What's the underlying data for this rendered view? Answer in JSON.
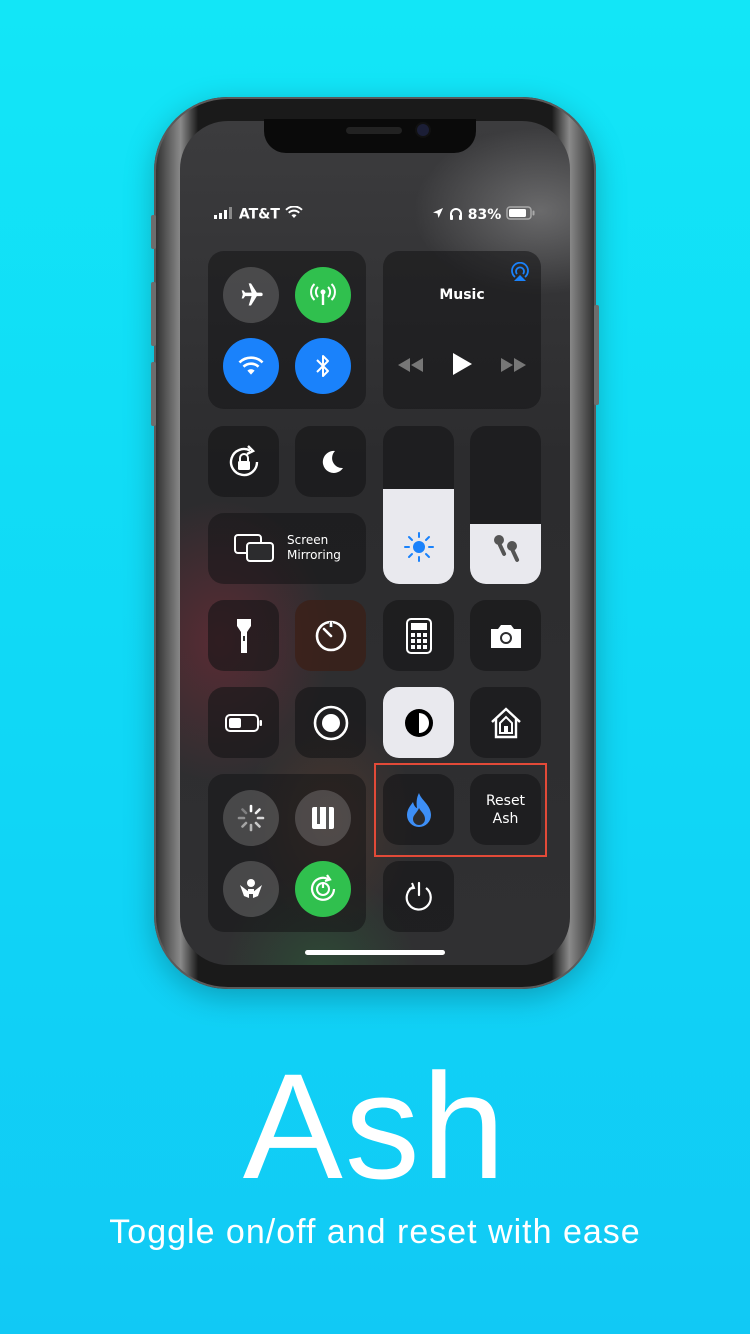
{
  "status_bar": {
    "carrier": "AT&T",
    "battery_percent": "83%"
  },
  "music": {
    "title": "Music"
  },
  "screen_mirroring": {
    "line1": "Screen",
    "line2": "Mirroring"
  },
  "brightness_level": 0.6,
  "volume_level": 0.38,
  "reset_ash": {
    "line1": "Reset",
    "line2": "Ash"
  },
  "promo": {
    "title": "Ash",
    "subtitle": "Toggle on/off and reset with ease"
  },
  "colors": {
    "background": "#12e0f7",
    "green": "#30c04e",
    "blue": "#1a82fb",
    "highlight": "#e24a38"
  },
  "icons": [
    "airplane-icon",
    "cellular-icon",
    "wifi-icon",
    "bluetooth-icon",
    "airplay-icon",
    "rewind-icon",
    "play-icon",
    "fast-forward-icon",
    "rotation-lock-icon",
    "moon-icon",
    "screen-mirroring-icon",
    "brightness-icon",
    "airpods-icon",
    "flashlight-icon",
    "timer-icon",
    "calculator-icon",
    "camera-icon",
    "low-power-icon",
    "screen-record-icon",
    "dark-mode-icon",
    "home-icon",
    "respring-icon",
    "ui-cache-icon",
    "safe-mode-icon",
    "reboot-icon",
    "flame-icon",
    "power-icon"
  ]
}
